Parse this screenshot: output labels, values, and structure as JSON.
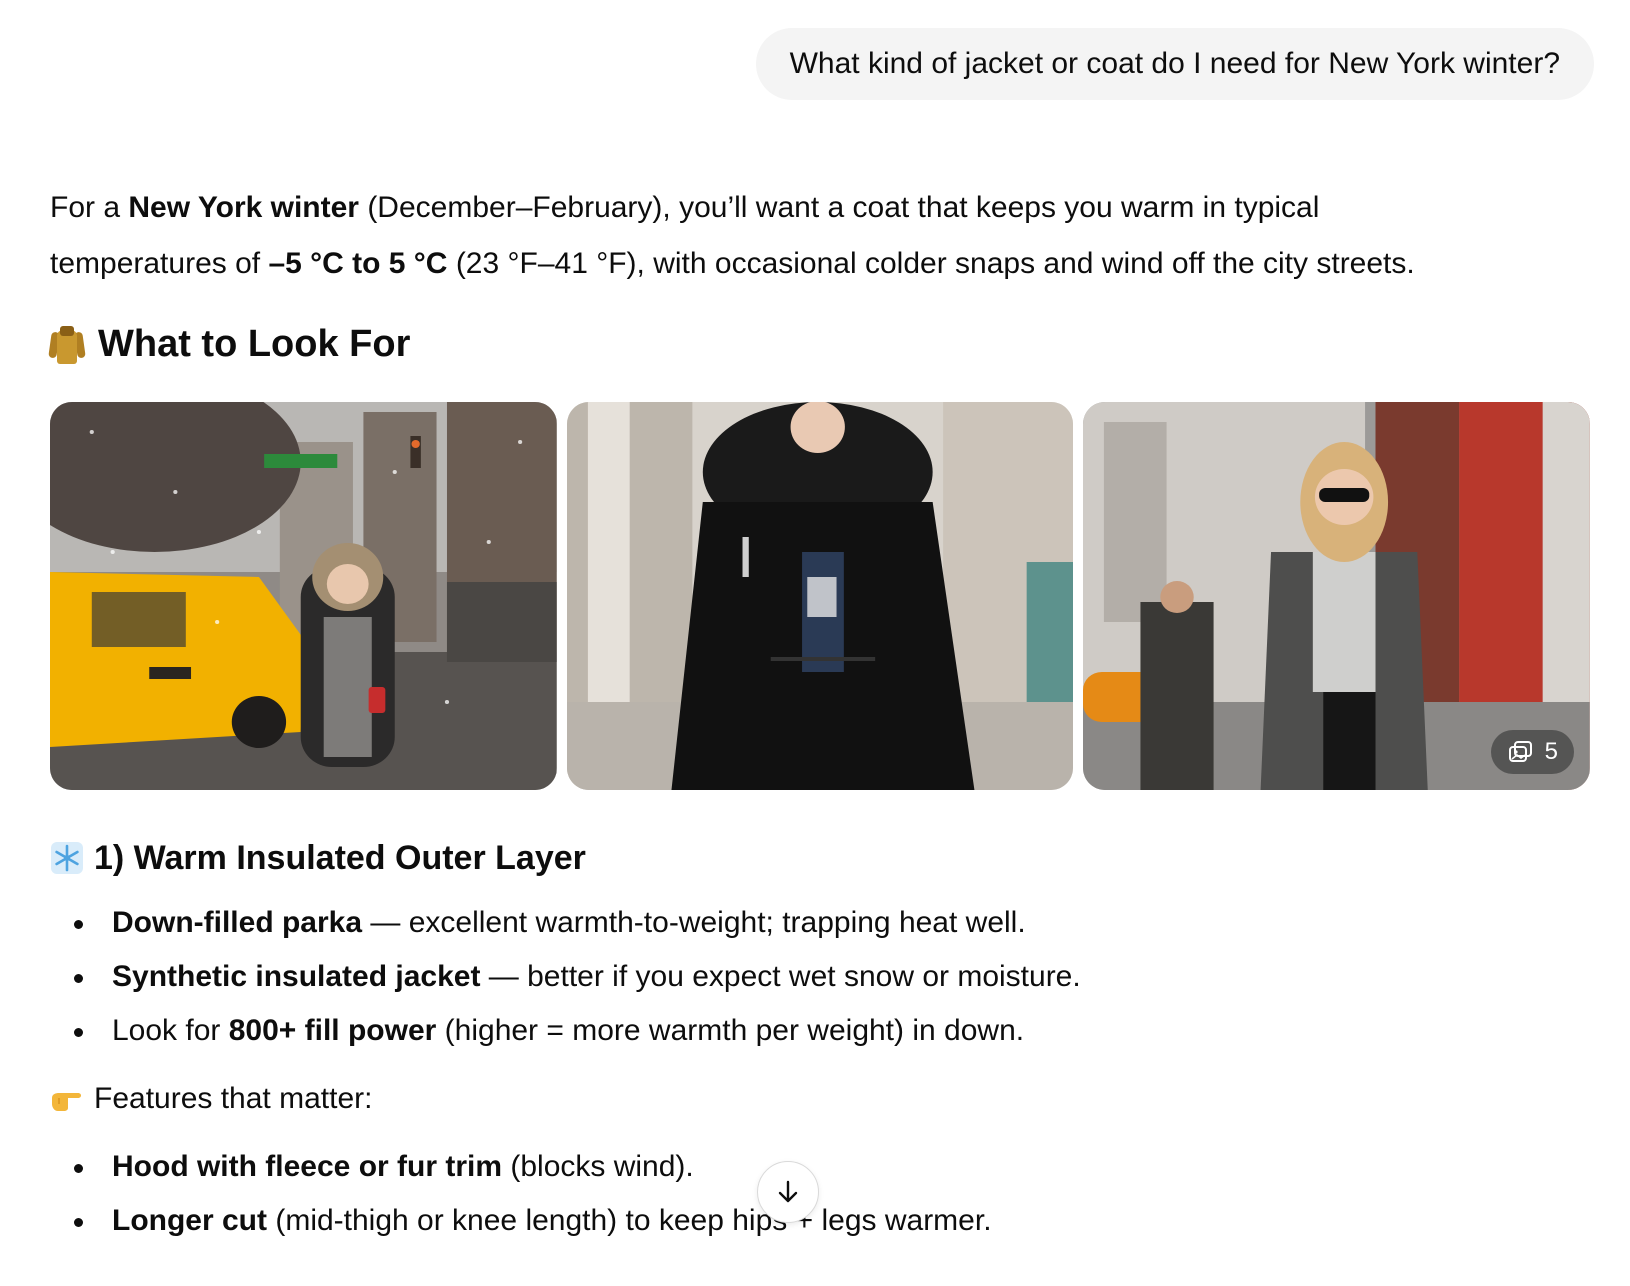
{
  "user_message": "What kind of jacket or coat do I need for New York winter?",
  "intro": {
    "p1_a": "For a ",
    "p1_b": "New York winter",
    "p1_c": " (December–February), you’ll want a coat that keeps you warm in typical",
    "p2_a": "temperatures of ",
    "p2_b": "–5 °C to 5 °C",
    "p2_c": " (23 °F–41 °F), with occasional colder snaps and wind off the city streets."
  },
  "heading_look": {
    "icon": "coat-icon",
    "text": "What to Look For"
  },
  "gallery": {
    "more_count": "5",
    "more_icon": "image-stack-icon",
    "photos": [
      "photo-taxi-snow",
      "photo-black-puffer",
      "photo-gray-coat"
    ]
  },
  "section1": {
    "icon": "snowflake-icon",
    "title": "1) Warm Insulated Outer Layer",
    "items": [
      {
        "bold": "Down-filled parka",
        "rest": " — excellent warmth-to-weight; trapping heat well."
      },
      {
        "bold": "Synthetic insulated jacket",
        "rest": " — better if you expect wet snow or moisture."
      },
      {
        "pre": "Look for ",
        "bold": "800+ fill power",
        "rest": " (higher = more warmth per weight) in down."
      }
    ]
  },
  "features": {
    "icon": "pointing-hand-icon",
    "text": "Features that matter:",
    "items": [
      {
        "bold": "Hood with fleece or fur trim",
        "rest": " (blocks wind)."
      },
      {
        "bold": "Longer cut",
        "rest": " (mid-thigh or knee length) to keep hips + legs warmer."
      }
    ]
  },
  "colors": {
    "bubble_bg": "#f4f4f4",
    "text": "#0d0d0d",
    "taxi_yellow": "#f2b100"
  },
  "scroll_icon": "arrow-down-icon"
}
